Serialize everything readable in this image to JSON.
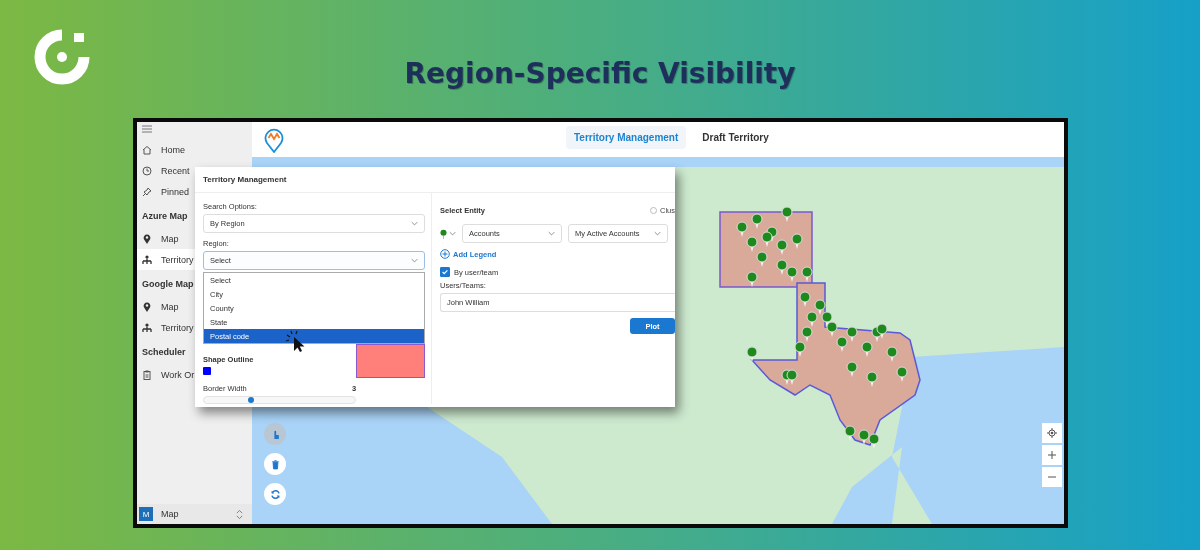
{
  "banner": {
    "title": "Region-Specific Visibility"
  },
  "sidebar": {
    "top_items": [
      {
        "label": "Home",
        "selected": false
      },
      {
        "label": "Recent",
        "selected": false
      },
      {
        "label": "Pinned",
        "selected": false
      }
    ],
    "groups": [
      {
        "title": "Azure Map",
        "items": [
          {
            "label": "Map",
            "selected": false
          },
          {
            "label": "Territory",
            "selected": true
          }
        ]
      },
      {
        "title": "Google Map",
        "items": [
          {
            "label": "Map",
            "selected": false
          },
          {
            "label": "Territory",
            "selected": false
          }
        ]
      },
      {
        "title": "Scheduler",
        "items": [
          {
            "label": "Work Or",
            "selected": false
          }
        ]
      }
    ],
    "footer": {
      "badge": "M",
      "label": "Map"
    }
  },
  "tabs": [
    {
      "label": "Territory Management",
      "selected": true
    },
    {
      "label": "Draft Territory",
      "selected": false
    }
  ],
  "dialog": {
    "title": "Territory Management",
    "search_options": {
      "label": "Search Options:",
      "value": "By Region"
    },
    "region": {
      "label": "Region:",
      "value": "Select",
      "expanded": true,
      "options": [
        {
          "label": "Select",
          "highlighted": false
        },
        {
          "label": "City",
          "highlighted": false
        },
        {
          "label": "County",
          "highlighted": false
        },
        {
          "label": "State",
          "highlighted": false
        },
        {
          "label": "Postal code",
          "highlighted": true
        }
      ]
    },
    "shape_outline": {
      "label": "Shape Outline"
    },
    "border_width": {
      "label": "Border Width",
      "reading": "3",
      "level": 0.31
    },
    "select_entity": {
      "label": "Select Entity"
    },
    "cluster": {
      "label": "Clus",
      "selected": false
    },
    "entity": {
      "value": "Accounts"
    },
    "view": {
      "value": "My Active Accounts"
    },
    "add_legend": {
      "label": "Add Legend"
    },
    "by_user": {
      "label": "By user/team",
      "checked": true
    },
    "users": {
      "label": "Users/Teams:",
      "value": "John William"
    },
    "plot": {
      "label": "Plot"
    }
  },
  "tools": [
    {
      "selected": true
    },
    {
      "selected": false
    },
    {
      "selected": false
    }
  ]
}
